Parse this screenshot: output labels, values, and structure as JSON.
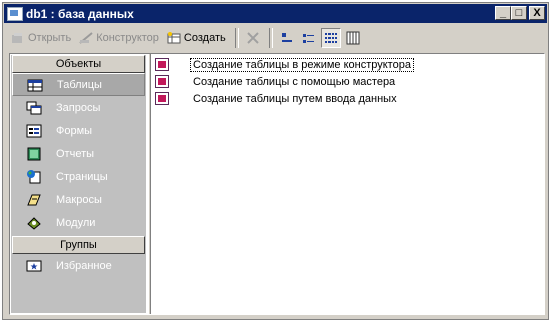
{
  "window": {
    "title": "db1 : база данных",
    "controls": {
      "minimize": "_",
      "maximize": "□",
      "close": "X"
    }
  },
  "toolbar": {
    "open_label": "Открыть",
    "design_label": "Конструктор",
    "create_label": "Создать"
  },
  "objects_header": "Объекты",
  "objects": [
    {
      "label": "Таблицы",
      "icon": "table-icon",
      "selected": true
    },
    {
      "label": "Запросы",
      "icon": "query-icon"
    },
    {
      "label": "Формы",
      "icon": "form-icon"
    },
    {
      "label": "Отчеты",
      "icon": "report-icon"
    },
    {
      "label": "Страницы",
      "icon": "page-icon"
    },
    {
      "label": "Макросы",
      "icon": "macro-icon"
    },
    {
      "label": "Модули",
      "icon": "module-icon"
    }
  ],
  "groups_header": "Группы",
  "groups": [
    {
      "label": "Избранное",
      "icon": "favorites-icon"
    }
  ],
  "list": [
    {
      "label": "Создание таблицы в режиме конструктора"
    },
    {
      "label": "Создание таблицы с помощью мастера"
    },
    {
      "label": "Создание таблицы путем ввода данных"
    }
  ]
}
